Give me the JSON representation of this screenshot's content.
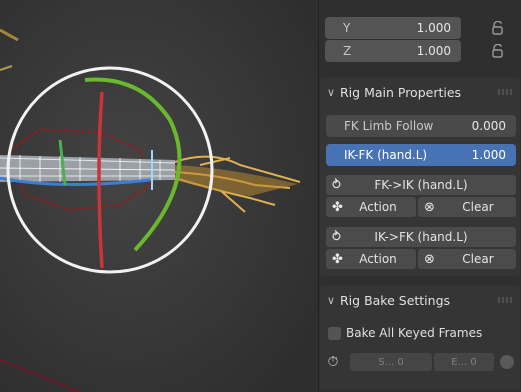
{
  "transform": {
    "y": {
      "label": "Y",
      "value": "1.000"
    },
    "z": {
      "label": "Z",
      "value": "1.000"
    },
    "lock_icon": "lock-open-icon"
  },
  "rig_main": {
    "header": "Rig Main Properties",
    "fk_limb_follow": {
      "label": "FK Limb Follow",
      "value": "0.000"
    },
    "ik_fk": {
      "label": "IK-FK (hand.L)",
      "value": "1.000"
    },
    "fk_to_ik": {
      "label": "FK->IK (hand.L)"
    },
    "ik_to_fk": {
      "label": "IK->FK (hand.L)"
    },
    "action_label": "Action",
    "clear_label": "Clear"
  },
  "rig_bake": {
    "header": "Rig Bake Settings",
    "bake_all_label": "Bake All Keyed Frames",
    "start_label": "S... 0",
    "end_label": "E... 0"
  },
  "colors": {
    "accent": "#4772b3",
    "viewport_bg": "#3b3b3b",
    "sidebar_bg": "#2f2f2f"
  }
}
